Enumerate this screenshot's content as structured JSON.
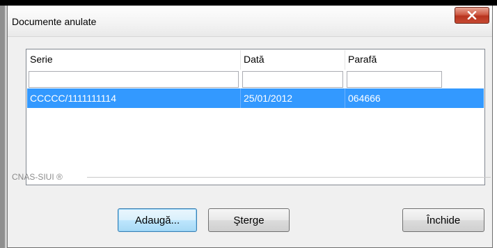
{
  "window": {
    "title": "Documente anulate",
    "close_icon": "close-x-icon"
  },
  "table": {
    "columns": [
      "Serie",
      "Dată",
      "Parafă"
    ],
    "filters": [
      "",
      "",
      ""
    ],
    "rows": [
      [
        "CCCCC/1111111114",
        "25/01/2012",
        "064666"
      ]
    ],
    "selected_row_color": "#3399ff"
  },
  "group": {
    "label": "CNAS-SIUI ®"
  },
  "buttons": {
    "add": "Adaugă...",
    "delete": "Şterge",
    "close": "Închide"
  }
}
